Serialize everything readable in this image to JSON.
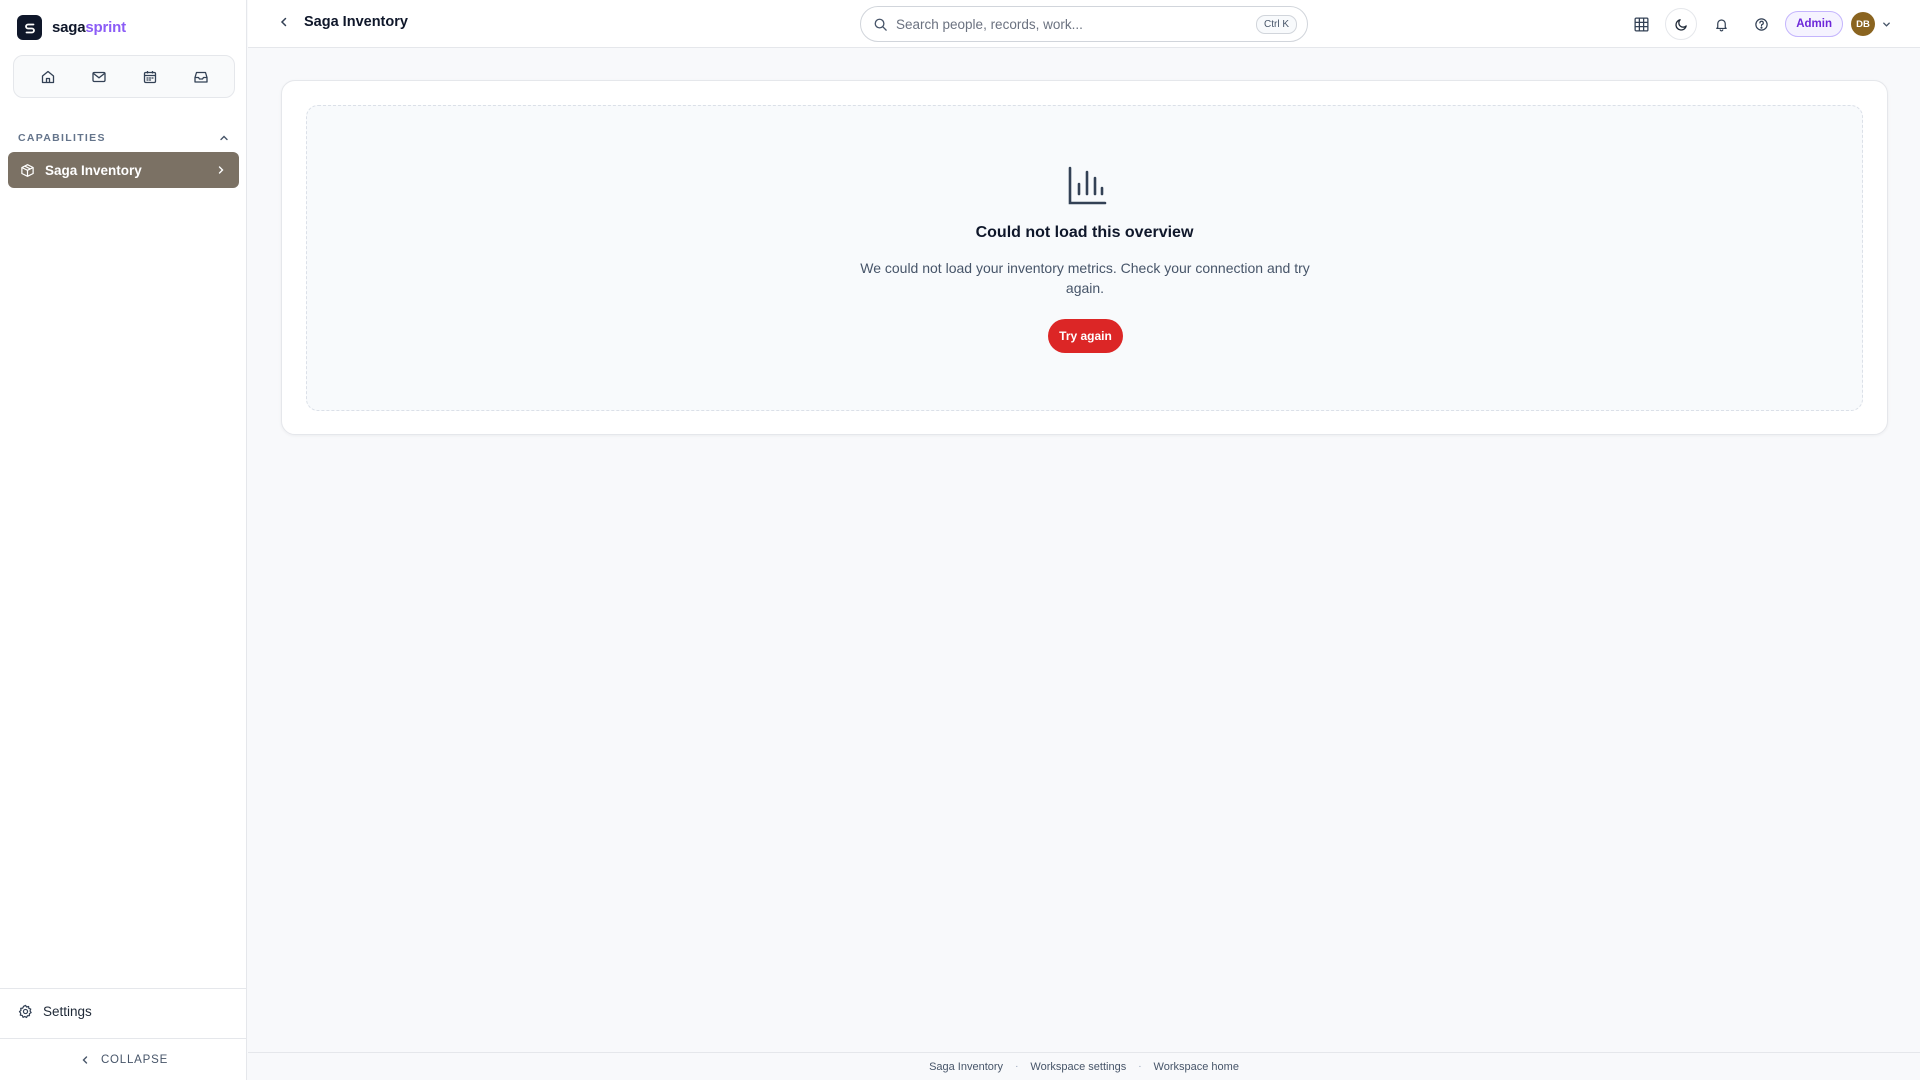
{
  "brand": {
    "name_primary": "saga",
    "name_accent": "sprint"
  },
  "quicknav": [
    {
      "icon": "home-icon"
    },
    {
      "icon": "mail-icon"
    },
    {
      "icon": "calendar-icon"
    },
    {
      "icon": "inbox-icon"
    }
  ],
  "sidebar": {
    "section_label": "CAPABILITIES",
    "items": [
      {
        "label": "Saga Inventory",
        "icon": "package-icon"
      }
    ],
    "settings_label": "Settings",
    "collapse_label": "COLLAPSE"
  },
  "header": {
    "title": "Saga Inventory",
    "search_placeholder": "Search people, records, work...",
    "search_shortcut": "Ctrl K",
    "role_badge": "Admin",
    "user_initials": "DB"
  },
  "overview": {
    "error_title": "Could not load this overview",
    "error_message": "We could not load your inventory metrics. Check your connection and try again.",
    "retry_label": "Try again"
  },
  "footer": {
    "links": [
      "Saga Inventory",
      "Workspace settings",
      "Workspace home"
    ],
    "separator": "·"
  },
  "colors": {
    "accent": "#8b5cf6",
    "active_nav_bg": "#7b7164",
    "danger": "#dc2626",
    "avatar_bg": "#8a6420"
  }
}
